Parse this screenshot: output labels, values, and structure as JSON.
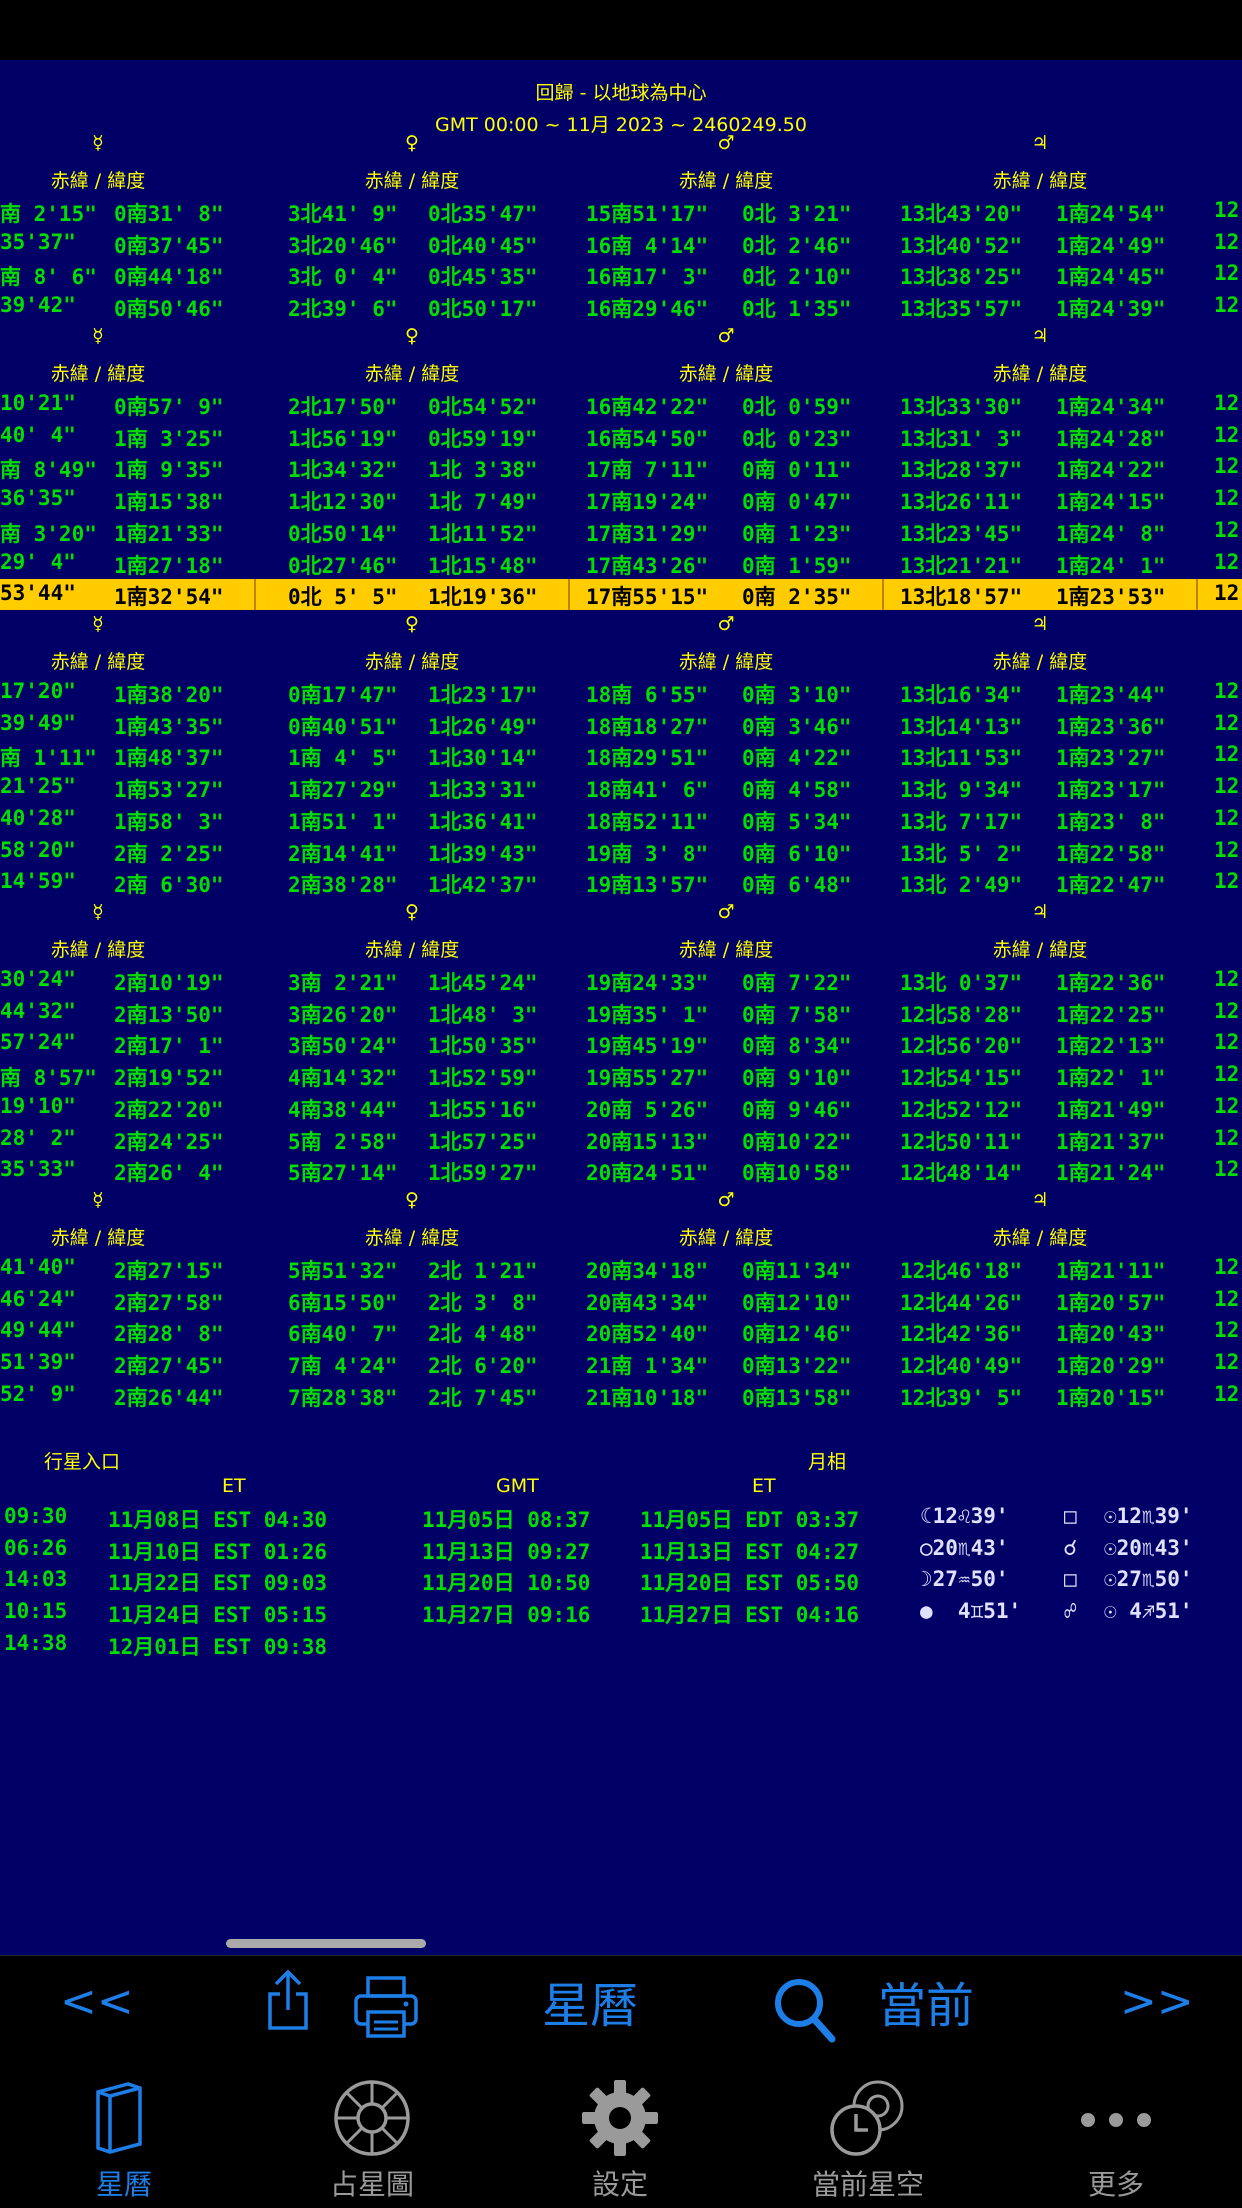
{
  "header": {
    "title": "回歸 - 以地球為中心",
    "subtitle": "GMT 00:00 ~ 11月 2023 ~ 2460249.50"
  },
  "col_header": "赤緯 / 緯度",
  "planet_symbols": [
    "☿",
    "♀",
    "♂",
    "♃"
  ],
  "blocks": [
    {
      "rows": [
        [
          "南 2'15\"",
          "0南31' 8\"",
          "3北41' 9\"",
          "0北35'47\"",
          "15南51'17\"",
          "0北 3'21\"",
          "13北43'20\"",
          "1南24'54\"",
          "12"
        ],
        [
          "35'37\"",
          "0南37'45\"",
          "3北20'46\"",
          "0北40'45\"",
          "16南 4'14\"",
          "0北 2'46\"",
          "13北40'52\"",
          "1南24'49\"",
          "12"
        ],
        [
          "南 8' 6\"",
          "0南44'18\"",
          "3北 0' 4\"",
          "0北45'35\"",
          "16南17' 3\"",
          "0北 2'10\"",
          "13北38'25\"",
          "1南24'45\"",
          "12"
        ],
        [
          "39'42\"",
          "0南50'46\"",
          "2北39' 6\"",
          "0北50'17\"",
          "16南29'46\"",
          "0北 1'35\"",
          "13北35'57\"",
          "1南24'39\"",
          "12"
        ]
      ]
    },
    {
      "rows": [
        [
          "10'21\"",
          "0南57' 9\"",
          "2北17'50\"",
          "0北54'52\"",
          "16南42'22\"",
          "0北 0'59\"",
          "13北33'30\"",
          "1南24'34\"",
          "12"
        ],
        [
          "40' 4\"",
          "1南 3'25\"",
          "1北56'19\"",
          "0北59'19\"",
          "16南54'50\"",
          "0北 0'23\"",
          "13北31' 3\"",
          "1南24'28\"",
          "12"
        ],
        [
          "南 8'49\"",
          "1南 9'35\"",
          "1北34'32\"",
          "1北 3'38\"",
          "17南 7'11\"",
          "0南 0'11\"",
          "13北28'37\"",
          "1南24'22\"",
          "12"
        ],
        [
          "36'35\"",
          "1南15'38\"",
          "1北12'30\"",
          "1北 7'49\"",
          "17南19'24\"",
          "0南 0'47\"",
          "13北26'11\"",
          "1南24'15\"",
          "12"
        ],
        [
          "南 3'20\"",
          "1南21'33\"",
          "0北50'14\"",
          "1北11'52\"",
          "17南31'29\"",
          "0南 1'23\"",
          "13北23'45\"",
          "1南24' 8\"",
          "12"
        ],
        [
          "29' 4\"",
          "1南27'18\"",
          "0北27'46\"",
          "1北15'48\"",
          "17南43'26\"",
          "0南 1'59\"",
          "13北21'21\"",
          "1南24' 1\"",
          "12"
        ],
        [
          "53'44\"",
          "1南32'54\"",
          "0北 5' 5\"",
          "1北19'36\"",
          "17南55'15\"",
          "0南 2'35\"",
          "13北18'57\"",
          "1南23'53\"",
          "12"
        ]
      ],
      "highlight_row": 6
    },
    {
      "rows": [
        [
          "17'20\"",
          "1南38'20\"",
          "0南17'47\"",
          "1北23'17\"",
          "18南 6'55\"",
          "0南 3'10\"",
          "13北16'34\"",
          "1南23'44\"",
          "12"
        ],
        [
          "39'49\"",
          "1南43'35\"",
          "0南40'51\"",
          "1北26'49\"",
          "18南18'27\"",
          "0南 3'46\"",
          "13北14'13\"",
          "1南23'36\"",
          "12"
        ],
        [
          "南 1'11\"",
          "1南48'37\"",
          "1南 4' 5\"",
          "1北30'14\"",
          "18南29'51\"",
          "0南 4'22\"",
          "13北11'53\"",
          "1南23'27\"",
          "12"
        ],
        [
          "21'25\"",
          "1南53'27\"",
          "1南27'29\"",
          "1北33'31\"",
          "18南41' 6\"",
          "0南 4'58\"",
          "13北 9'34\"",
          "1南23'17\"",
          "12"
        ],
        [
          "40'28\"",
          "1南58' 3\"",
          "1南51' 1\"",
          "1北36'41\"",
          "18南52'11\"",
          "0南 5'34\"",
          "13北 7'17\"",
          "1南23' 8\"",
          "12"
        ],
        [
          "58'20\"",
          "2南 2'25\"",
          "2南14'41\"",
          "1北39'43\"",
          "19南 3' 8\"",
          "0南 6'10\"",
          "13北 5' 2\"",
          "1南22'58\"",
          "12"
        ],
        [
          "14'59\"",
          "2南 6'30\"",
          "2南38'28\"",
          "1北42'37\"",
          "19南13'57\"",
          "0南 6'48\"",
          "13北 2'49\"",
          "1南22'47\"",
          "12"
        ]
      ]
    },
    {
      "rows": [
        [
          "30'24\"",
          "2南10'19\"",
          "3南 2'21\"",
          "1北45'24\"",
          "19南24'33\"",
          "0南 7'22\"",
          "13北 0'37\"",
          "1南22'36\"",
          "12"
        ],
        [
          "44'32\"",
          "2南13'50\"",
          "3南26'20\"",
          "1北48' 3\"",
          "19南35' 1\"",
          "0南 7'58\"",
          "12北58'28\"",
          "1南22'25\"",
          "12"
        ],
        [
          "57'24\"",
          "2南17' 1\"",
          "3南50'24\"",
          "1北50'35\"",
          "19南45'19\"",
          "0南 8'34\"",
          "12北56'20\"",
          "1南22'13\"",
          "12"
        ],
        [
          "南 8'57\"",
          "2南19'52\"",
          "4南14'32\"",
          "1北52'59\"",
          "19南55'27\"",
          "0南 9'10\"",
          "12北54'15\"",
          "1南22' 1\"",
          "12"
        ],
        [
          "19'10\"",
          "2南22'20\"",
          "4南38'44\"",
          "1北55'16\"",
          "20南 5'26\"",
          "0南 9'46\"",
          "12北52'12\"",
          "1南21'49\"",
          "12"
        ],
        [
          "28' 2\"",
          "2南24'25\"",
          "5南 2'58\"",
          "1北57'25\"",
          "20南15'13\"",
          "0南10'22\"",
          "12北50'11\"",
          "1南21'37\"",
          "12"
        ],
        [
          "35'33\"",
          "2南26' 4\"",
          "5南27'14\"",
          "1北59'27\"",
          "20南24'51\"",
          "0南10'58\"",
          "12北48'14\"",
          "1南21'24\"",
          "12"
        ]
      ]
    },
    {
      "rows": [
        [
          "41'40\"",
          "2南27'15\"",
          "5南51'32\"",
          "2北 1'21\"",
          "20南34'18\"",
          "0南11'34\"",
          "12北46'18\"",
          "1南21'11\"",
          "12"
        ],
        [
          "46'24\"",
          "2南27'58\"",
          "6南15'50\"",
          "2北 3' 8\"",
          "20南43'34\"",
          "0南12'10\"",
          "12北44'26\"",
          "1南20'57\"",
          "12"
        ],
        [
          "49'44\"",
          "2南28' 8\"",
          "6南40' 7\"",
          "2北 4'48\"",
          "20南52'40\"",
          "0南12'46\"",
          "12北42'36\"",
          "1南20'43\"",
          "12"
        ],
        [
          "51'39\"",
          "2南27'45\"",
          "7南 4'24\"",
          "2北 6'20\"",
          "21南 1'34\"",
          "0南13'22\"",
          "12北40'49\"",
          "1南20'29\"",
          "12"
        ],
        [
          "52' 9\"",
          "2南26'44\"",
          "7南28'38\"",
          "2北 7'45\"",
          "21南10'18\"",
          "0南13'58\"",
          "12北39' 5\"",
          "1南20'15\"",
          "12"
        ]
      ]
    }
  ],
  "ingress": {
    "title": "行星入口",
    "col_et": "ET",
    "rows": [
      [
        "09:30",
        "11月08日 EST 04:30"
      ],
      [
        "06:26",
        "11月10日 EST 01:26"
      ],
      [
        "14:03",
        "11月22日 EST 09:03"
      ],
      [
        "10:15",
        "11月24日 EST 05:15"
      ],
      [
        "14:38",
        "12月01日 EST 09:38"
      ]
    ]
  },
  "moon_phase": {
    "title": "月相",
    "col_gmt": "GMT",
    "col_et": "ET",
    "rows": [
      [
        "11月05日 08:37",
        "11月05日 EDT 03:37",
        "☾12♌39'",
        "□",
        "☉12♏39'"
      ],
      [
        "11月13日 09:27",
        "11月13日 EST 04:27",
        "○20♏43'",
        "☌",
        "☉20♏43'"
      ],
      [
        "11月20日 10:50",
        "11月20日 EST 05:50",
        "☽27♒50'",
        "□",
        "☉27♏50'"
      ],
      [
        "11月27日 09:16",
        "11月27日 EST 04:16",
        "●  4♊51'",
        "☍",
        "☉ 4♐51'"
      ]
    ]
  },
  "toolbar": {
    "prev": "<<",
    "title": "星曆",
    "current": "當前",
    "next": ">>"
  },
  "tabs": [
    {
      "label": "星曆",
      "icon": "book-icon",
      "active": true
    },
    {
      "label": "占星圖",
      "icon": "wheel-icon",
      "active": false
    },
    {
      "label": "設定",
      "icon": "gear-icon",
      "active": false
    },
    {
      "label": "當前星空",
      "icon": "clock-chart-icon",
      "active": false
    },
    {
      "label": "更多",
      "icon": "more-dots-icon",
      "active": false
    }
  ],
  "colors": {
    "background": "#000066",
    "header_text": "#ffff00",
    "value_text": "#00dd00",
    "highlight": "#ffcc00",
    "accent": "#1e7ee8"
  }
}
